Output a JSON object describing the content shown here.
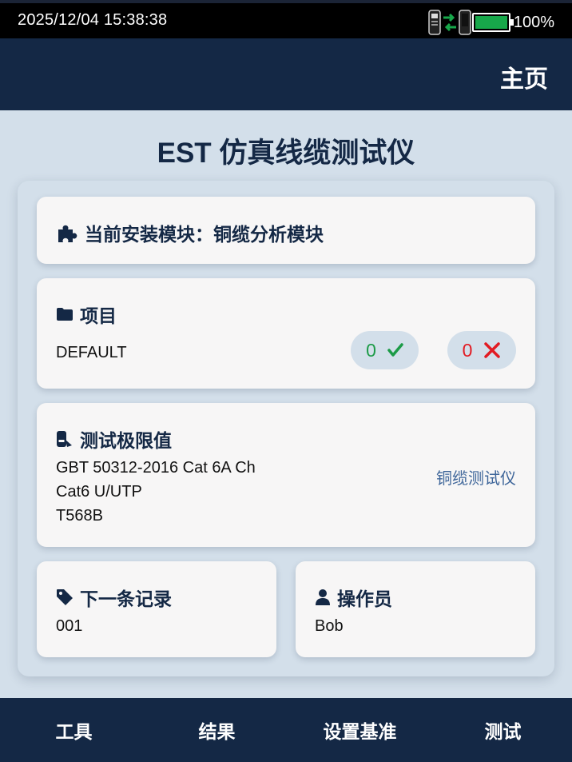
{
  "status": {
    "datetime": "2025/12/04 15:38:38",
    "battery_percent": "100%",
    "battery_level": 1.0,
    "connection_icon": "device-connection-icon",
    "battery_color": "#17a84a"
  },
  "appbar": {
    "home_label": "主页",
    "color": "#142845"
  },
  "page": {
    "title": "EST 仿真线缆测试仪"
  },
  "module": {
    "label": "当前安装模块：铜缆分析模块",
    "icon": "puzzle-icon"
  },
  "project": {
    "title": "项目",
    "icon": "folder-icon",
    "name": "DEFAULT",
    "pass_count": "0",
    "fail_count": "0",
    "pass_icon": "check-icon",
    "fail_icon": "cross-icon",
    "pass_color": "#1c9b47",
    "fail_color": "#e21b23"
  },
  "limits": {
    "title": "测试极限值",
    "icon": "limit-icon",
    "line1": "GBT 50312-2016 Cat 6A Ch",
    "line2": "Cat6 U/UTP",
    "line3": "T568B",
    "device": "铜缆测试仪"
  },
  "next_record": {
    "title": "下一条记录",
    "icon": "tag-icon",
    "value": "001"
  },
  "operator": {
    "title": "操作员",
    "icon": "user-icon",
    "value": "Bob"
  },
  "nav": {
    "tools": "工具",
    "results": "结果",
    "set_reference": "设置基准",
    "test": "测试"
  }
}
